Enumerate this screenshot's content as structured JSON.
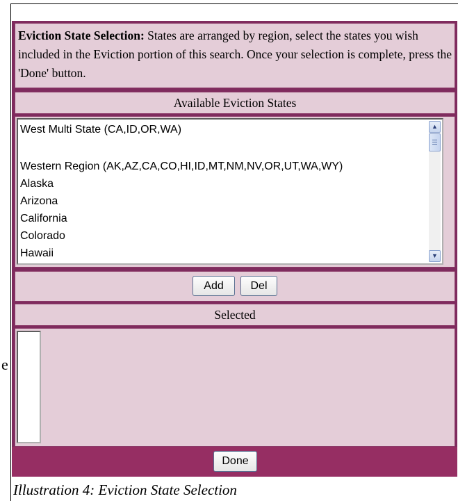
{
  "intro": {
    "title": "Eviction State Selection:",
    "text": "States are arranged by region, select the states you wish included in the Eviction portion of this search. Once your selection is complete, press the 'Done' button."
  },
  "available": {
    "header": "Available Eviction States",
    "items": [
      "West Multi State (CA,ID,OR,WA)",
      "",
      "Western Region (AK,AZ,CA,CO,HI,ID,MT,NM,NV,OR,UT,WA,WY)",
      "Alaska",
      "Arizona",
      "California",
      "Colorado",
      "Hawaii"
    ]
  },
  "buttons": {
    "add_label": "Add",
    "del_label": "Del",
    "done_label": "Done"
  },
  "selected": {
    "header": "Selected",
    "items": []
  },
  "caption": "Illustration 4: Eviction State Selection",
  "stray_char": "e",
  "colors": {
    "panel_bg": "#e4cdd8",
    "border": "#7f2b5e",
    "footer_bg": "#962e63"
  },
  "icons": {
    "scroll_up": "chevron-up-icon",
    "scroll_down": "chevron-down-icon"
  }
}
